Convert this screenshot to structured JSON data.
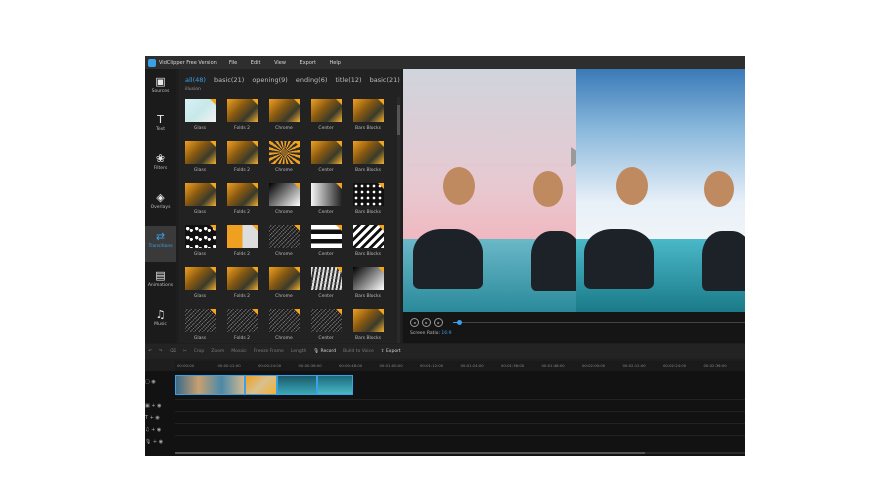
{
  "window": {
    "title": "VidClipper Free Version",
    "menu": [
      "File",
      "Edit",
      "View",
      "Export",
      "Help"
    ],
    "accent": "#3aa0e8"
  },
  "sidebar": {
    "items": [
      {
        "label": "Sources",
        "icon": "folder-icon"
      },
      {
        "label": "Text",
        "icon": "text-icon"
      },
      {
        "label": "Filters",
        "icon": "filters-icon"
      },
      {
        "label": "Overlays",
        "icon": "layers-icon"
      },
      {
        "label": "Transitions",
        "icon": "transition-icon",
        "active": true
      },
      {
        "label": "Animations",
        "icon": "animation-icon"
      },
      {
        "label": "Music",
        "icon": "music-icon"
      }
    ]
  },
  "library": {
    "tabs": [
      "all(48)",
      "basic(21)",
      "opening(9)",
      "ending(6)",
      "title(12)",
      "basic(21)"
    ],
    "active_tab": 0,
    "subtab": "illusion",
    "rows": [
      [
        "Glass",
        "Folds 2",
        "Chrome",
        "Center",
        "Bars Blocks"
      ],
      [
        "Glass",
        "Folds 2",
        "Chrome",
        "Center",
        "Bars Blocks"
      ],
      [
        "Glass",
        "Folds 2",
        "Chrome",
        "Center",
        "Bars Blocks"
      ],
      [
        "Glass",
        "Folds 2",
        "Chrome",
        "Center",
        "Bars Blocks"
      ],
      [
        "Glass",
        "Folds 2",
        "Chrome",
        "Center",
        "Bars Blocks"
      ],
      [
        "Glass",
        "Folds 2",
        "Chrome",
        "Center",
        "Bars Blocks"
      ]
    ]
  },
  "preview": {
    "screen_ratio_label": "Screen Ratio:",
    "screen_ratio_value": "16:9",
    "playback_progress": 0.02
  },
  "toolbar": {
    "items": [
      "Crop",
      "Zoom",
      "Mosaic",
      "Freeze Frame",
      "Length",
      "Record",
      "Build to Voice",
      "Export"
    ]
  },
  "timeline": {
    "ruler": [
      "00:00:00",
      "00:00:12:00",
      "00:00:24:00",
      "00:00:36:00",
      "00:00:48:00",
      "00:01:00:00",
      "00:01:12:00",
      "00:01:24:00",
      "00:01:36:00",
      "00:01:48:00",
      "00:02:00:00",
      "00:02:12:00",
      "00:02:24:00",
      "00:02:36:00"
    ]
  }
}
